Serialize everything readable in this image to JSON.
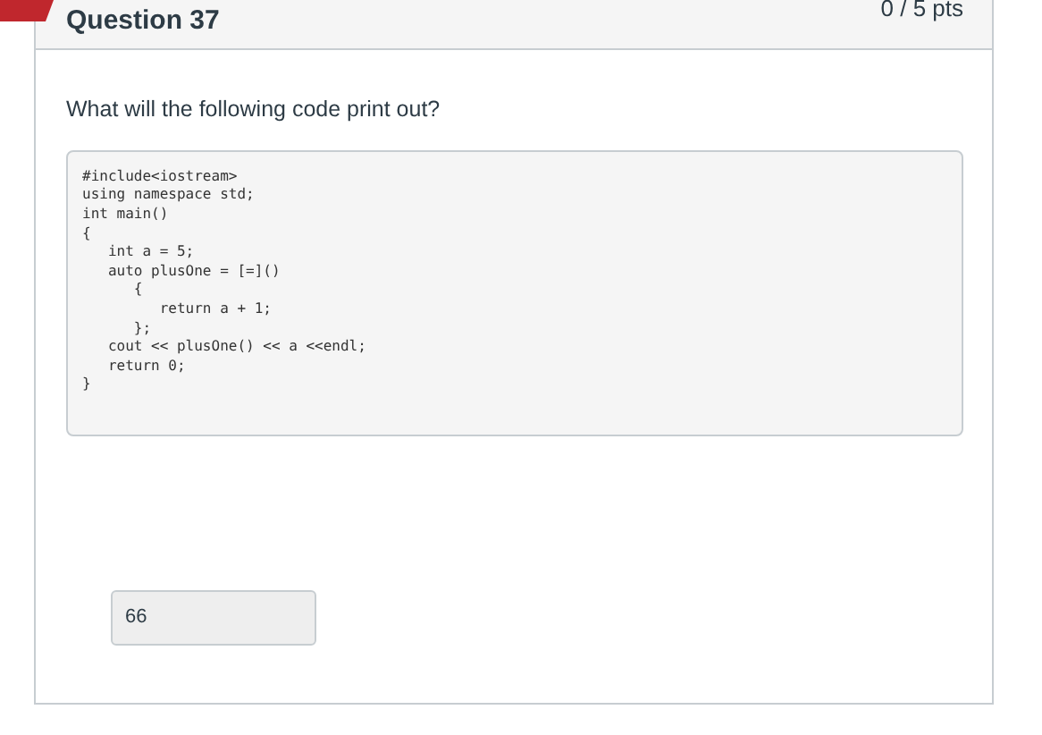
{
  "question": {
    "title": "Question 37",
    "points": "0 / 5 pts"
  },
  "prompt": "What will the following code print out?",
  "code_lines": [
    "#include<iostream>",
    "using namespace std;",
    "int main()",
    "{",
    "   int a = 5;",
    "   auto plusOne = [=]()",
    "      {",
    "         return a + 1;",
    "      };",
    "   cout << plusOne() << a <<endl;",
    "   return 0;",
    "}"
  ],
  "answer": {
    "value": "66"
  }
}
